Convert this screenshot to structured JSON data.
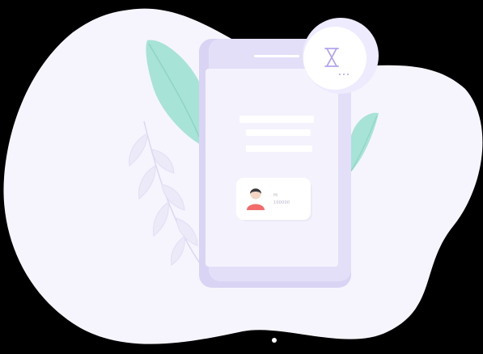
{
  "profile_card": {
    "line_1": "Hi",
    "line_2": "100000"
  },
  "colors": {
    "blob": "#f6f4fd",
    "phone_frame": "#ddd8f6",
    "phone_screen": "#f3f1fc",
    "leaf": "#9ee0d2",
    "accent": "#b4a4f0",
    "avatar_hair": "#3a3a3a",
    "avatar_body": "#f26c6c"
  },
  "icons": [
    "hourglass-icon",
    "avatar-icon",
    "leaf-decoration",
    "fern-decoration"
  ]
}
